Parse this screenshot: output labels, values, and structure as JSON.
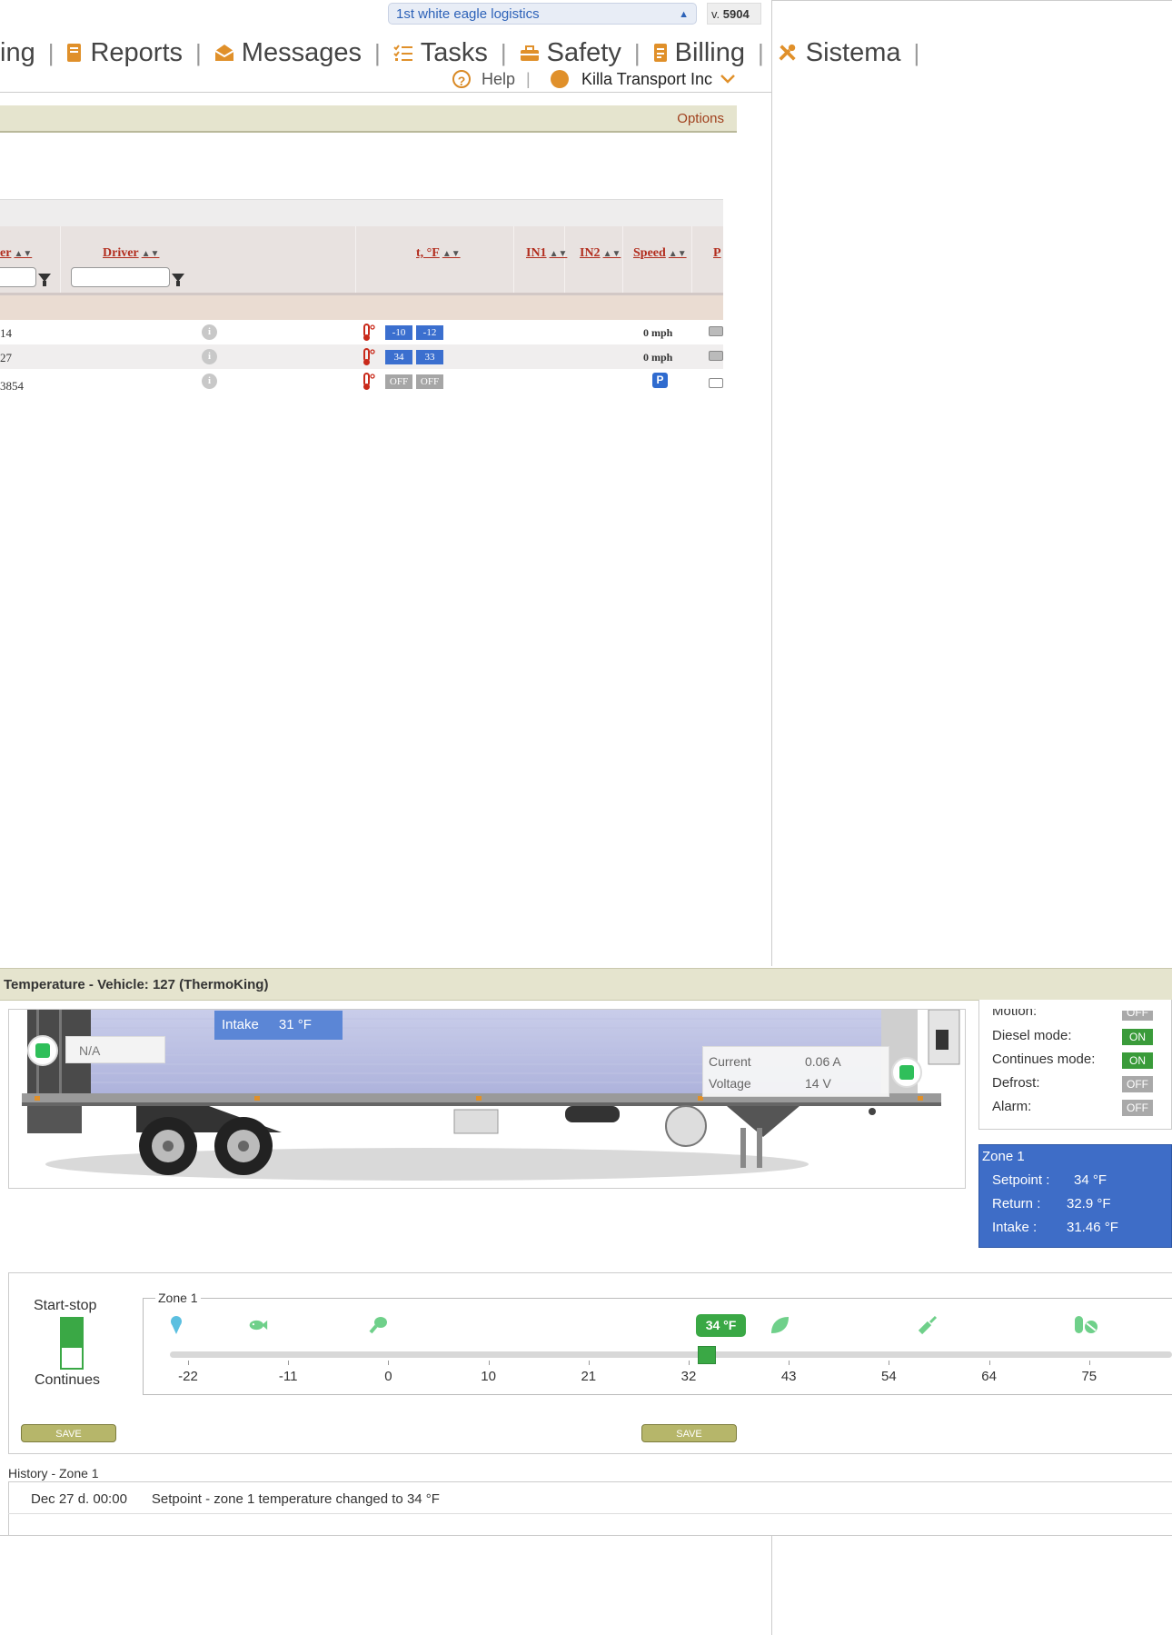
{
  "company_select": {
    "value": "1st white eagle logistics"
  },
  "version": {
    "prefix": "v.",
    "number": "5904"
  },
  "nav": {
    "items": [
      {
        "label": "ing",
        "icon": "truncated"
      },
      {
        "label": "Reports",
        "icon": "book-icon"
      },
      {
        "label": "Messages",
        "icon": "envelope-icon"
      },
      {
        "label": "Tasks",
        "icon": "list-check-icon"
      },
      {
        "label": "Safety",
        "icon": "toolbox-icon"
      },
      {
        "label": "Billing",
        "icon": "invoice-icon"
      },
      {
        "label": "Sistema",
        "icon": "tools-icon"
      }
    ],
    "help": "Help",
    "help_icon": "?",
    "user": "Killa Transport Inc"
  },
  "options": {
    "label": "Options"
  },
  "table": {
    "columns": {
      "driver_prefix": "er",
      "driver": "Driver",
      "temp": "t, °F",
      "in1": "IN1",
      "in2": "IN2",
      "speed": "Speed",
      "power": "P"
    },
    "rows": [
      {
        "id": "14",
        "t1": "-10",
        "t2": "-12",
        "temp_state": "blue",
        "speed": "0 mph",
        "power": "battery"
      },
      {
        "id": "27",
        "t1": "34",
        "t2": "33",
        "temp_state": "blue",
        "speed": "0 mph",
        "power": "battery"
      },
      {
        "id": "3854",
        "t1": "OFF",
        "t2": "OFF",
        "temp_state": "gray",
        "speed": "P",
        "power": "battery-empty"
      }
    ]
  },
  "temperature_panel": {
    "title": "Temperature - Vehicle: 127 (ThermoKing)",
    "intake": {
      "label": "Intake",
      "value": "31 °F"
    },
    "na": "N/A",
    "current": {
      "label": "Current",
      "value": "0.06 A"
    },
    "voltage": {
      "label": "Voltage",
      "value": "14 V"
    },
    "status": [
      {
        "label": "Motion:",
        "value": "OFF"
      },
      {
        "label": "Diesel mode:",
        "value": "ON"
      },
      {
        "label": "Continues mode:",
        "value": "ON"
      },
      {
        "label": "Defrost:",
        "value": "OFF"
      },
      {
        "label": "Alarm:",
        "value": "OFF"
      }
    ],
    "zone": {
      "title": "Zone 1",
      "setpoint_label": "Setpoint :",
      "setpoint": "34 °F",
      "return_label": "Return :",
      "return": "32.9 °F",
      "intake_label": "Intake :",
      "intake": "31.46 °F"
    }
  },
  "setpoint_control": {
    "start_stop": "Start-stop",
    "continues": "Continues",
    "zone_label": "Zone 1",
    "setpoint_display": "34 °F",
    "setpoint_value": 34,
    "scale_min": -22,
    "scale_max": 75,
    "ticks": [
      "-22",
      "-11",
      "0",
      "10",
      "21",
      "32",
      "43",
      "54",
      "64",
      "75"
    ],
    "product_icons": [
      "ice-cream-icon",
      "fish-icon",
      "drumstick-icon",
      "leaf-icon",
      "bottle-icon",
      "pill-icon"
    ],
    "save_label": "SAVE",
    "colors": {
      "accent": "#3aa845",
      "save": "#b6b66a"
    }
  },
  "history": {
    "title": "History - Zone 1",
    "entries": [
      {
        "time": "Dec 27 d. 00:00",
        "text": "Setpoint - zone 1 temperature changed to 34 °F"
      }
    ]
  }
}
